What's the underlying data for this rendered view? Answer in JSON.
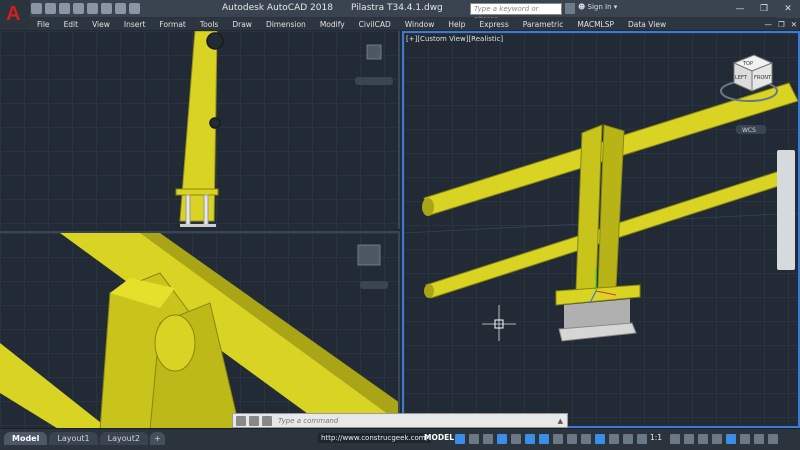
{
  "app": {
    "title": "Autodesk AutoCAD 2018",
    "file": "Pilastra T34.4.1.dwg",
    "search_placeholder": "Type a keyword or phrase",
    "sign_in": "Sign In"
  },
  "menu": [
    "File",
    "Edit",
    "View",
    "Insert",
    "Format",
    "Tools",
    "Draw",
    "Dimension",
    "Modify",
    "CivilCAD",
    "Window",
    "Help",
    "Express",
    "Parametric",
    "MACMLSP",
    "Data View"
  ],
  "viewports": {
    "right_label": "[+][Custom View][Realistic]",
    "wcs": "WCS",
    "cube_top": "TOP",
    "cube_left": "LEFT",
    "cube_front": "FRONT"
  },
  "command": {
    "placeholder": "Type a command"
  },
  "status": {
    "tabs": [
      "Model",
      "Layout1",
      "Layout2",
      "+"
    ],
    "url": "http://www.construcgeek.com/",
    "mode": "MODEL",
    "scale": "1:1"
  },
  "colors": {
    "model_yellow": "#d9d424",
    "model_yellow_dark": "#a9a516",
    "viewport_bg": "#222b35",
    "active_border": "#3a7bd5"
  }
}
